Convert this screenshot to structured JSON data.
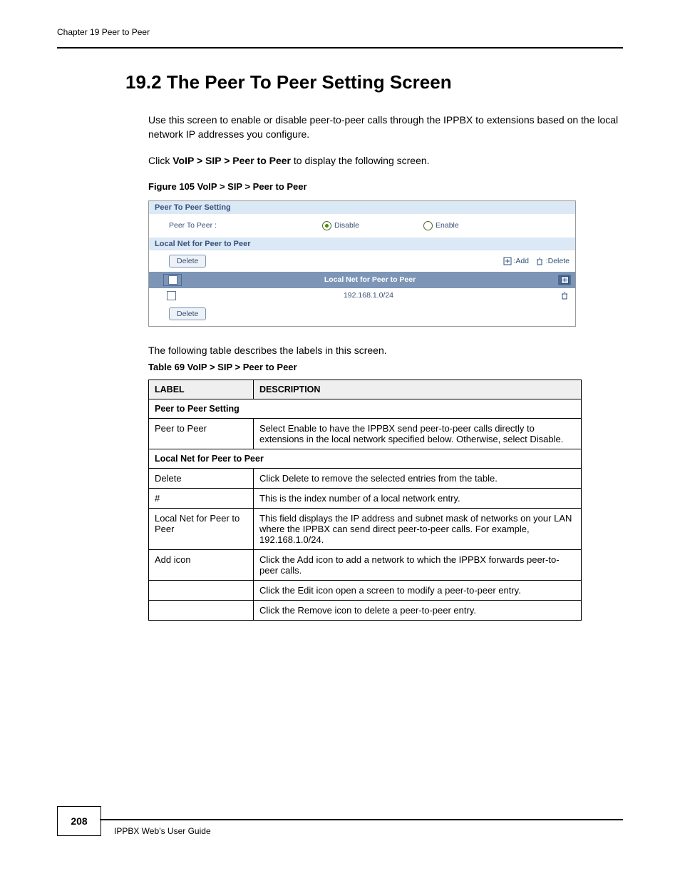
{
  "header": {
    "chapter": "Chapter 19 Peer to Peer"
  },
  "section_title": "19.2  The Peer To Peer Setting Screen",
  "intro_para_1": "Use this screen to enable or disable peer-to-peer calls through the IPPBX to extensions based on the local network IP addresses you configure.",
  "intro_para_2_pre": "Click ",
  "intro_para_2_bold": "VoIP > SIP > Peer to Peer",
  "intro_para_2_post": " to display the following screen.",
  "figure_caption": "Figure 105   VoIP > SIP > Peer to Peer",
  "shot": {
    "band1": "Peer To Peer Setting",
    "p2p_label": "Peer To Peer :",
    "radio_disable": "Disable",
    "radio_enable": "Enable",
    "band2": "Local Net for Peer to Peer",
    "btn_delete": "Delete",
    "legend_add": ":Add",
    "legend_delete": ":Delete",
    "tbl_header": "Local Net for Peer to Peer",
    "row_value": "192.168.1.0/24"
  },
  "table_caption": "The following table describes the labels in this screen.",
  "table_title": "Table 69   VoIP > SIP > Peer to Peer",
  "tbl": {
    "head_label": "LABEL",
    "head_desc": "DESCRIPTION",
    "group1": "Peer to Peer Setting",
    "r1_label": "Peer to Peer",
    "r1_desc": "Select Enable to have the IPPBX send peer-to-peer calls directly to extensions in the local network specified below. Otherwise, select Disable.",
    "group2": "Local Net for Peer to Peer",
    "r2_label": "Delete",
    "r2_desc": "Click Delete to remove the selected entries from the table.",
    "r3_label": "#",
    "r3_desc": "This is the index number of a local network entry.",
    "r4_label": "Local Net for Peer to Peer",
    "r4_desc": "This field displays the IP address and subnet mask of networks on your LAN where the IPPBX can send direct peer-to-peer calls. For example, 192.168.1.0/24.",
    "r5_label": "Add icon",
    "r5_desc": "Click the Add icon to add a network to which the IPPBX forwards peer-to-peer calls.",
    "r6_label": "",
    "r6_desc": "Click the Edit icon open a screen to modify a peer-to-peer entry.",
    "r7_label": "",
    "r7_desc": "Click the Remove icon to delete a peer-to-peer entry."
  },
  "page_number": "208",
  "guide_title": "IPPBX Web’s User Guide"
}
